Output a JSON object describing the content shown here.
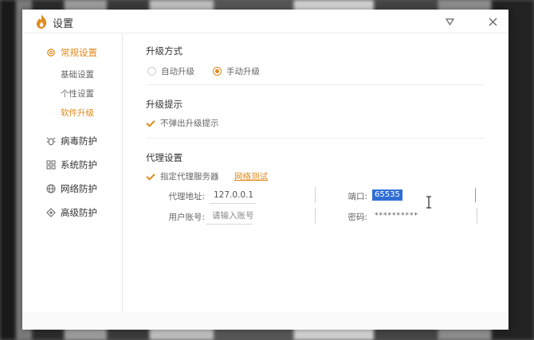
{
  "window": {
    "title": "设置"
  },
  "sidebar": {
    "groups": [
      {
        "label": "常规设置",
        "icon": "gear-icon",
        "active": true,
        "subs": [
          {
            "label": "基础设置",
            "active": false
          },
          {
            "label": "个性设置",
            "active": false
          },
          {
            "label": "软件升级",
            "active": true
          }
        ]
      },
      {
        "label": "病毒防护",
        "icon": "bug-icon"
      },
      {
        "label": "系统防护",
        "icon": "grid-icon"
      },
      {
        "label": "网络防护",
        "icon": "globe-icon"
      },
      {
        "label": "高级防护",
        "icon": "diamond-icon"
      }
    ]
  },
  "upgrade_mode": {
    "title": "升级方式",
    "options": [
      {
        "label": "自动升级",
        "checked": false
      },
      {
        "label": "手动升级",
        "checked": true
      }
    ]
  },
  "upgrade_tip": {
    "title": "升级提示",
    "checkbox_label": "不弹出升级提示"
  },
  "proxy": {
    "title": "代理设置",
    "enable_label": "指定代理服务器",
    "test_link": "网络测试",
    "address_label": "代理地址:",
    "address_value": "127.0.0.1",
    "port_label": "端口:",
    "port_value": "65535",
    "user_label": "用户账号:",
    "user_value": "请输入账号",
    "password_label": "密码:",
    "password_value": "**********"
  },
  "colors": {
    "accent": "#e18a1d",
    "selection": "#2f6fd6"
  }
}
